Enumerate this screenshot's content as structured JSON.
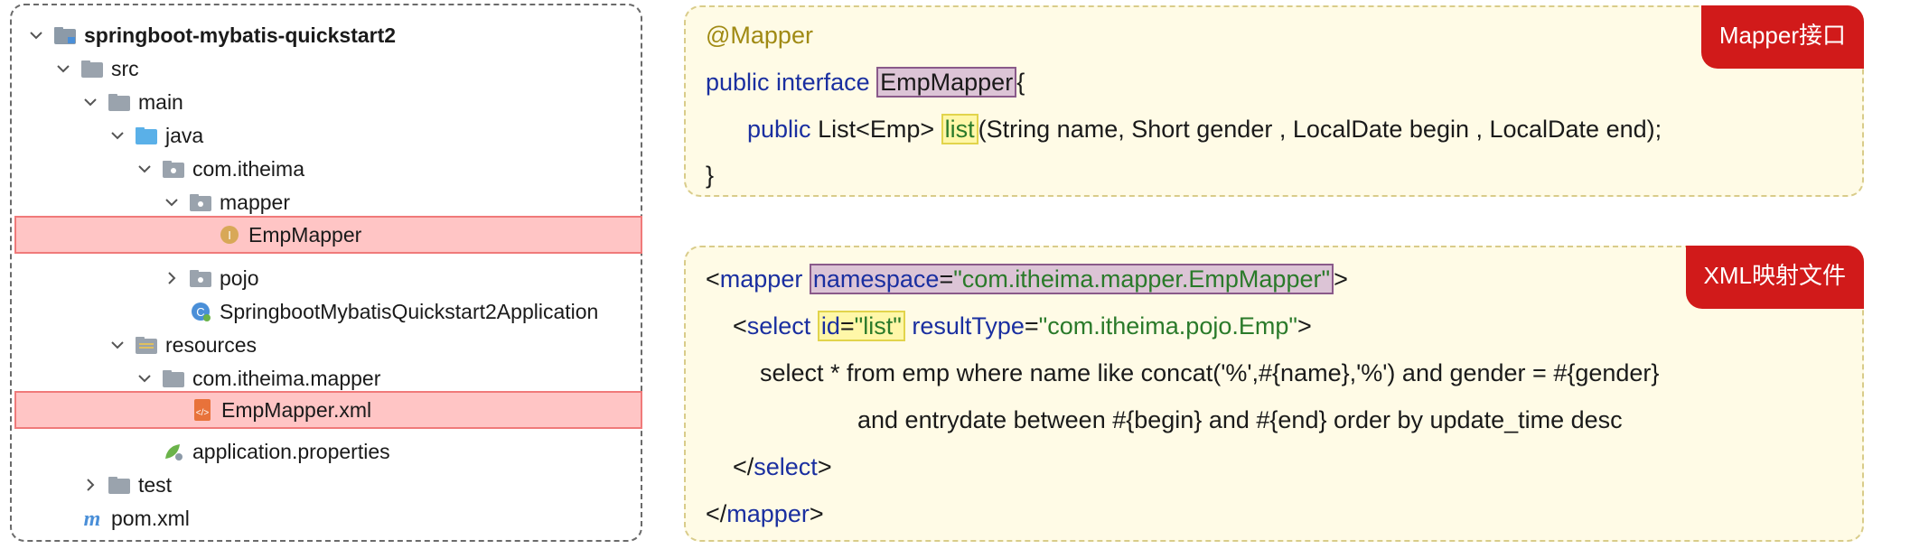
{
  "tree": {
    "items": [
      {
        "label": "springboot-mybatis-quickstart2",
        "icon": "module-folder-icon"
      },
      {
        "label": "src",
        "icon": "folder-icon"
      },
      {
        "label": "main",
        "icon": "folder-icon"
      },
      {
        "label": "java",
        "icon": "source-folder-icon"
      },
      {
        "label": "com.itheima",
        "icon": "package-icon"
      },
      {
        "label": "mapper",
        "icon": "package-icon"
      },
      {
        "label": "EmpMapper",
        "icon": "interface-icon"
      },
      {
        "label": "pojo",
        "icon": "package-icon"
      },
      {
        "label": "SpringbootMybatisQuickstart2Application",
        "icon": "spring-class-icon"
      },
      {
        "label": "resources",
        "icon": "resources-folder-icon"
      },
      {
        "label": "com.itheima.mapper",
        "icon": "folder-icon"
      },
      {
        "label": "EmpMapper.xml",
        "icon": "xml-file-icon"
      },
      {
        "label": "application.properties",
        "icon": "properties-file-icon"
      },
      {
        "label": "test",
        "icon": "folder-icon"
      },
      {
        "label": "pom.xml",
        "icon": "maven-icon"
      }
    ]
  },
  "mapper_card": {
    "tag": "Mapper接口",
    "l1": "@Mapper",
    "l2_kw": "public interface",
    "l2_name": "EmpMapper",
    "l2_end": "{",
    "l3_kw": "public",
    "l3_type": "List<Emp>",
    "l3_method": "list",
    "l3_params": "(String name, Short gender , LocalDate begin , LocalDate end);",
    "l4": "}"
  },
  "xml_card": {
    "tag": "XML映射文件",
    "l1_open": "<",
    "l1_tag": "mapper",
    "l1_attr": "namespace",
    "l1_eq": "=",
    "l1_val": "\"com.itheima.mapper.EmpMapper\"",
    "l1_close": ">",
    "l2_open": "<",
    "l2_tag": "select",
    "l2_idattr": "id",
    "l2_eq1": "=",
    "l2_idval": "\"list\"",
    "l2_rtattr": "resultType",
    "l2_eq2": "=",
    "l2_rtval": "\"com.itheima.pojo.Emp\"",
    "l2_close": ">",
    "l3": "select * from emp where name like concat('%',#{name},'%') and gender = #{gender}",
    "l4": "and entrydate between #{begin} and #{end} order by update_time desc",
    "l5_open": "</",
    "l5_tag": "select",
    "l5_close": ">",
    "l6_open": "</",
    "l6_tag": "mapper",
    "l6_close": ">"
  },
  "colors": {
    "highlight_row": "#ffc5c5",
    "tag_bg": "#d11a1a",
    "card_bg": "#fffbe6",
    "keyword": "#1a2fa0",
    "string": "#2a7a2a",
    "annotation": "#a08a14"
  }
}
